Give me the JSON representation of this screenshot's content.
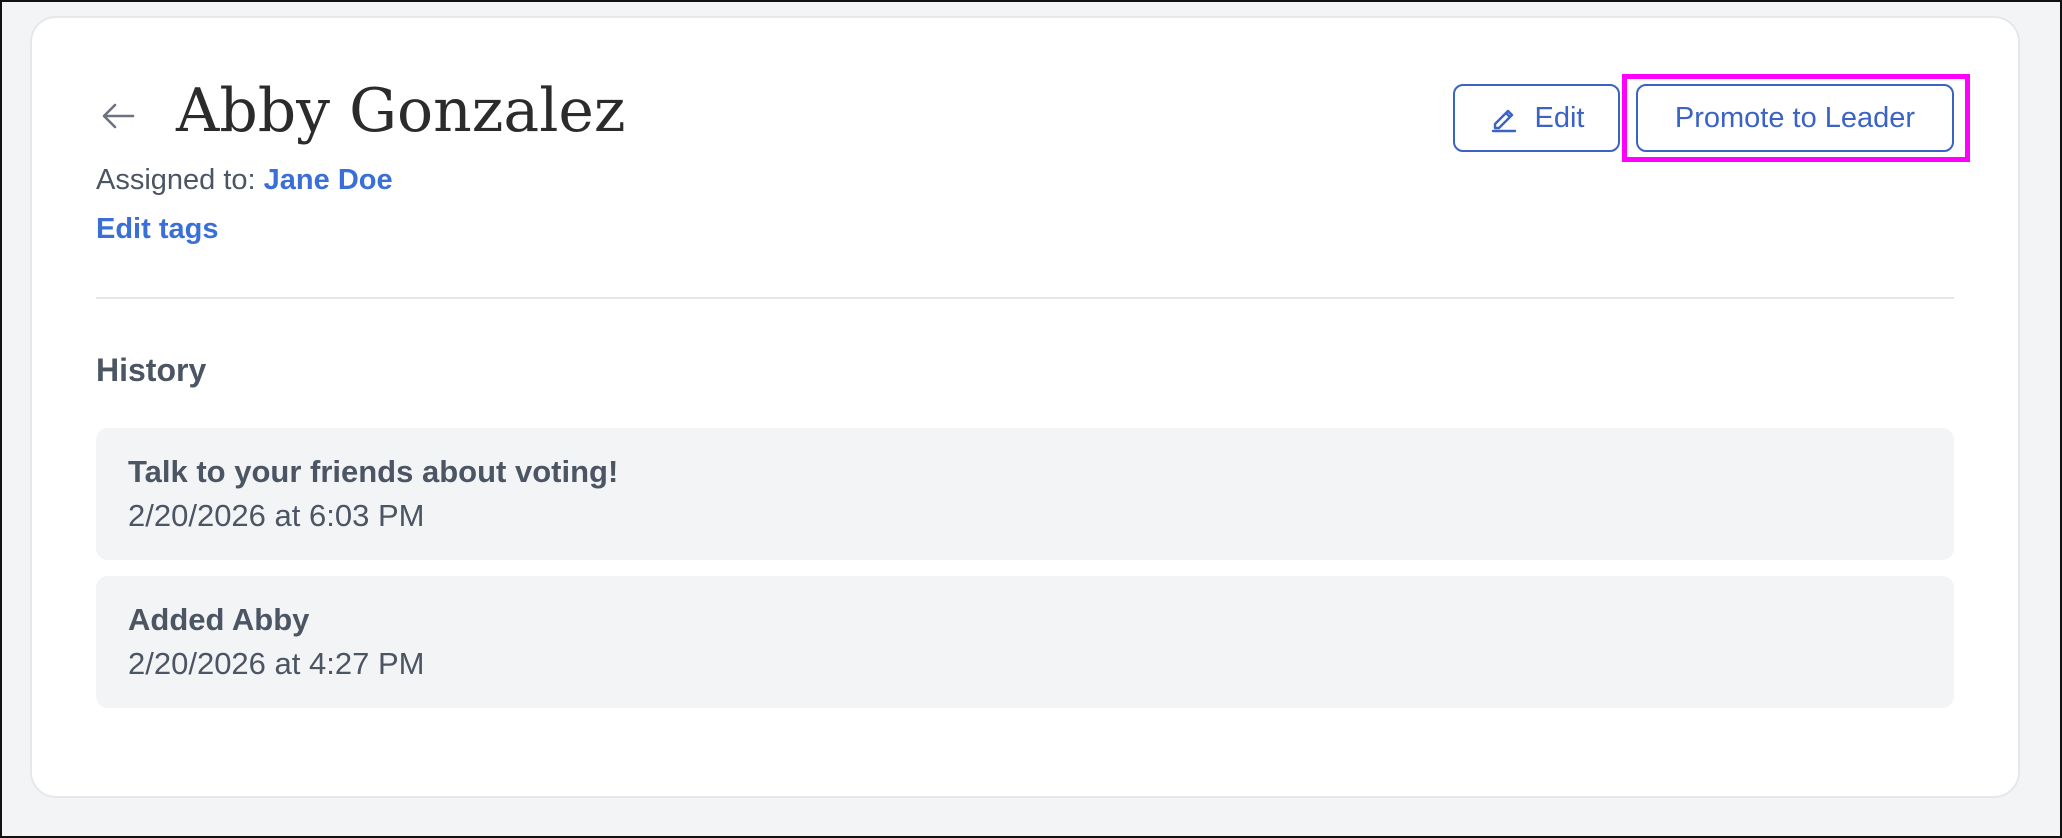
{
  "contact": {
    "name": "Abby Gonzalez",
    "assigned_label": "Assigned to:",
    "assigned_to": "Jane Doe",
    "edit_tags_label": "Edit tags"
  },
  "actions": {
    "edit_label": "Edit",
    "promote_label": "Promote to Leader"
  },
  "icons": {
    "back": "arrow-left-icon",
    "edit": "pencil-icon"
  },
  "history": {
    "title": "History",
    "items": [
      {
        "title": "Talk to your friends about voting!",
        "time": "2/20/2026 at 6:03 PM"
      },
      {
        "title": "Added Abby",
        "time": "2/20/2026 at 4:27 PM"
      }
    ]
  },
  "colors": {
    "accent": "#3b6fd8",
    "button_border": "#3b63c4",
    "highlight": "#ff00ff",
    "history_bg": "#f3f4f6"
  }
}
